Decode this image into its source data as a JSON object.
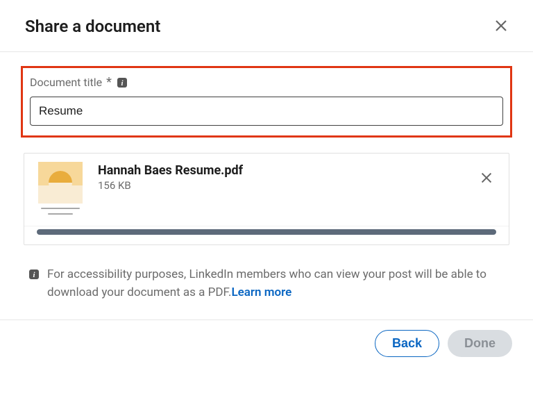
{
  "header": {
    "title": "Share a document"
  },
  "form": {
    "title_label": "Document title",
    "required_mark": "*",
    "title_value": "Resume"
  },
  "upload": {
    "file_name": "Hannah Baes Resume.pdf",
    "file_size": "156 KB"
  },
  "note": {
    "text": "For accessibility purposes, LinkedIn members who can view your post will be able to download your document as a PDF.",
    "learn_more": "Learn more"
  },
  "footer": {
    "back": "Back",
    "done": "Done"
  }
}
